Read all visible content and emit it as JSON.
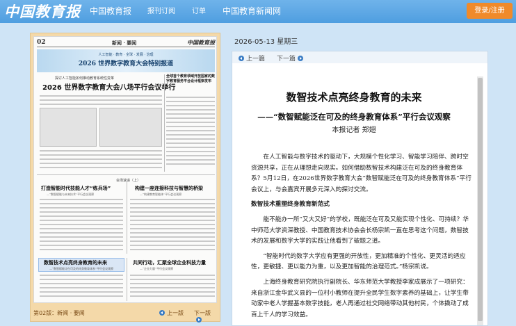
{
  "header": {
    "logo_text": "中国教育报",
    "nav": [
      "中国教育报",
      "报刊订阅",
      "订单",
      "中国教育新闻网"
    ],
    "login_label": "登录/注册",
    "colors": {
      "bar": "#4f9ee0",
      "login": "#f08a2a"
    }
  },
  "paper": {
    "page_number": "02",
    "section": "新闻 · 要闻",
    "masthead": "中国教育报",
    "banner_subtitle": "人工智能 · 教育 · 全球 · 发展 · 治理",
    "banner_title": "2026 世界数字教育大会特别报道",
    "kicker": "探讨人工智能如何推动教育系统性变革",
    "headline": "2026 世界数字教育大会八场平行会议举行",
    "sidebar_text": "全球首个教育领域开放国家的数字教育服务平台设计框架发布",
    "series_label": "会场速递（上）",
    "articles": [
      {
        "title": "打造智能时代技能人才“练兵场”",
        "kicker": "—“数智赋能与未来技术”平行会议观察"
      },
      {
        "title": "构建一座连接科技与智慧的桥梁",
        "kicker": "—“构建教育智能体”平行会议观察"
      },
      {
        "title": "数智技术点亮终身教育的未来",
        "kicker": "—“数智赋能泛在可及的终身教育体系”平行会议观察"
      },
      {
        "title": "共同行动，汇聚全球企业科技力量",
        "kicker": "—“企业力量”平行会议观察"
      }
    ],
    "footer": {
      "label": "第02版：新闻 · 要闻",
      "prev": "上一版",
      "next": "下一版"
    }
  },
  "reader": {
    "date": "2026-05-13  星期三",
    "prev_article": "上一篇",
    "next_article": "下一篇",
    "title": "数智技术点亮终身教育的未来",
    "subtitle": "——“数智赋能泛在可及的终身教育体系”平行会议观察",
    "byline": "本报记者  郑翅",
    "body": {
      "p1": "在人工智能与数字技术的驱动下，大规模个性化学习、智能学习陪伴、跨时空资源共享，正在从理想走向现实。如何借助数智技术构建泛在可及的终身教育体系？5月12日，在2026世界数字教育大会“数智赋能泛在可及的终身教育体系”平行会议上，与会嘉宾开展多元深入的探讨交流。",
      "section1": "数智技术重塑终身教育新范式",
      "p2": "能不能办一所“又大又好”的学校，既能泛在可及又能实现个性化、可持续？华中师范大学资深教授、中国教育技术协会会长杨宗凯一直在思考这个问题，数智技术的发展和数字大学的实践让他看到了破题之道。",
      "p3": "“智能时代的数字大学应有更强的开放性，更加精准的个性化、更灵活的适应性，更敏捷、更以能力为重，以及更加智能的治理范式。”杨宗凯说。",
      "p4": "上海终身教育研究院执行副院长、华东师范大学教授李家成展示了一项研究：来自浙江金华武义县的一位村小教师在提升全民学生数字素养的基础上，让学生带动家中老人学握基本数字技能，老人再通过社交网络带动其他村民，个体撬动了成百上千人的学习效益。"
    }
  }
}
